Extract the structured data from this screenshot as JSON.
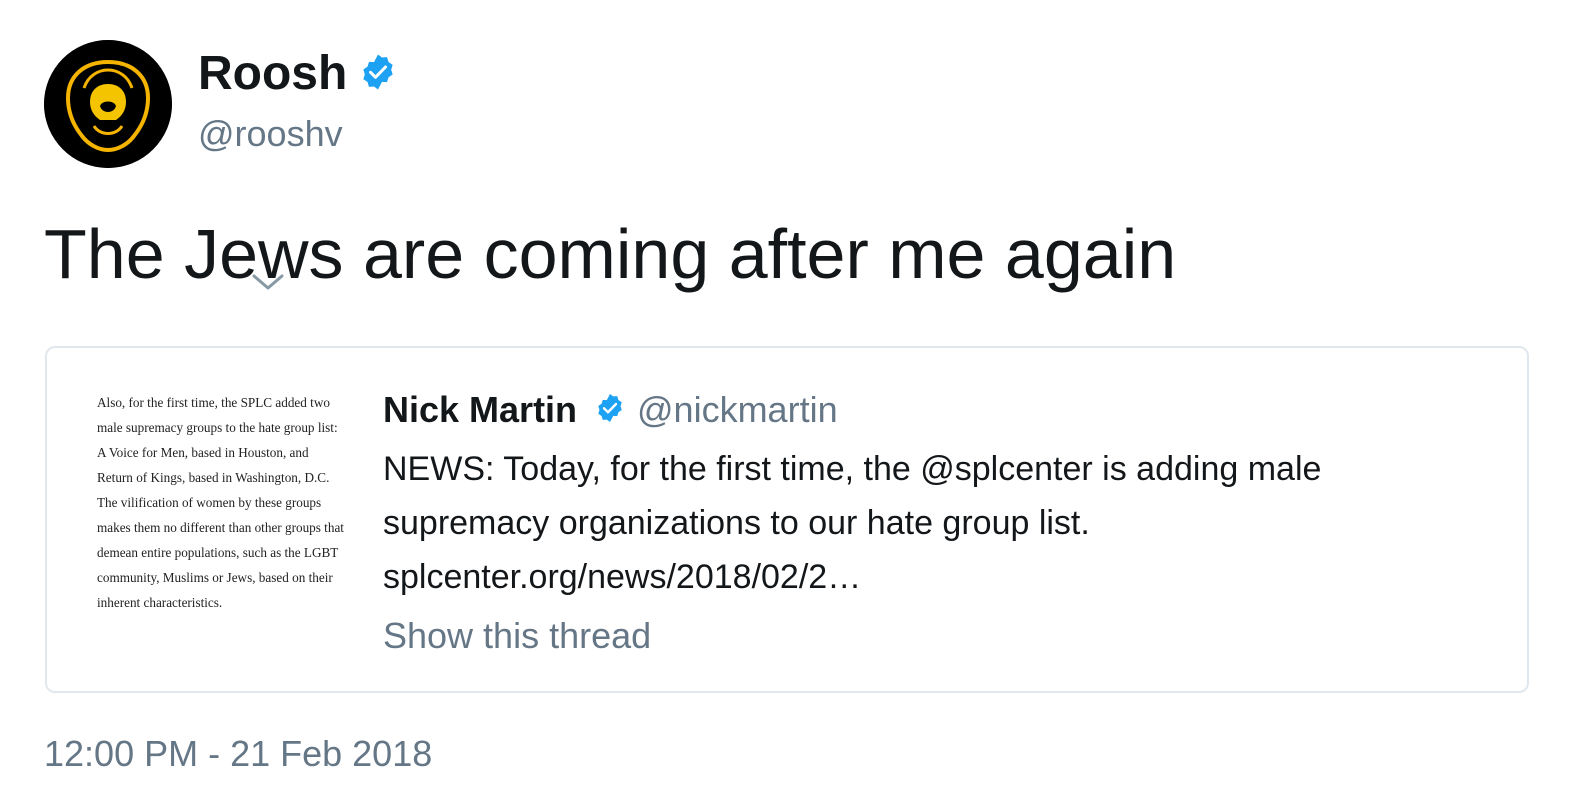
{
  "author": {
    "display_name": "Roosh",
    "handle": "@rooshv",
    "avatar": "bearded-face-avatar",
    "verified_icon": "verified-badge-icon"
  },
  "tweet": {
    "text": "The Jews are coming after me again",
    "timestamp": "12:00 PM - 21 Feb 2018",
    "menu_icon": "chevron-down-icon"
  },
  "quoted_tweet": {
    "image_excerpt": "Also, for the first time, the SPLC added two male supremacy groups to the hate group list: A Voice for Men, based in Houston, and Return of Kings, based in Washington, D.C. The vilification of women by these groups makes them no different than other groups that demean entire populations, such as the LGBT community, Muslims or Jews, based on their inherent characteristics.",
    "display_name": "Nick Martin",
    "handle": "@nickmartin",
    "text_lines": [
      "NEWS: Today, for the first time, the @splcenter is adding male",
      "supremacy organizations to our hate group list.",
      "splcenter.org/news/2018/02/2…"
    ],
    "show_thread": "Show this thread"
  },
  "colors": {
    "verified_blue": "#1da1f2",
    "secondary_text": "#657786",
    "primary_text": "#14171a",
    "border": "#e1e8ed",
    "avatar_accent": "#f5b400"
  }
}
